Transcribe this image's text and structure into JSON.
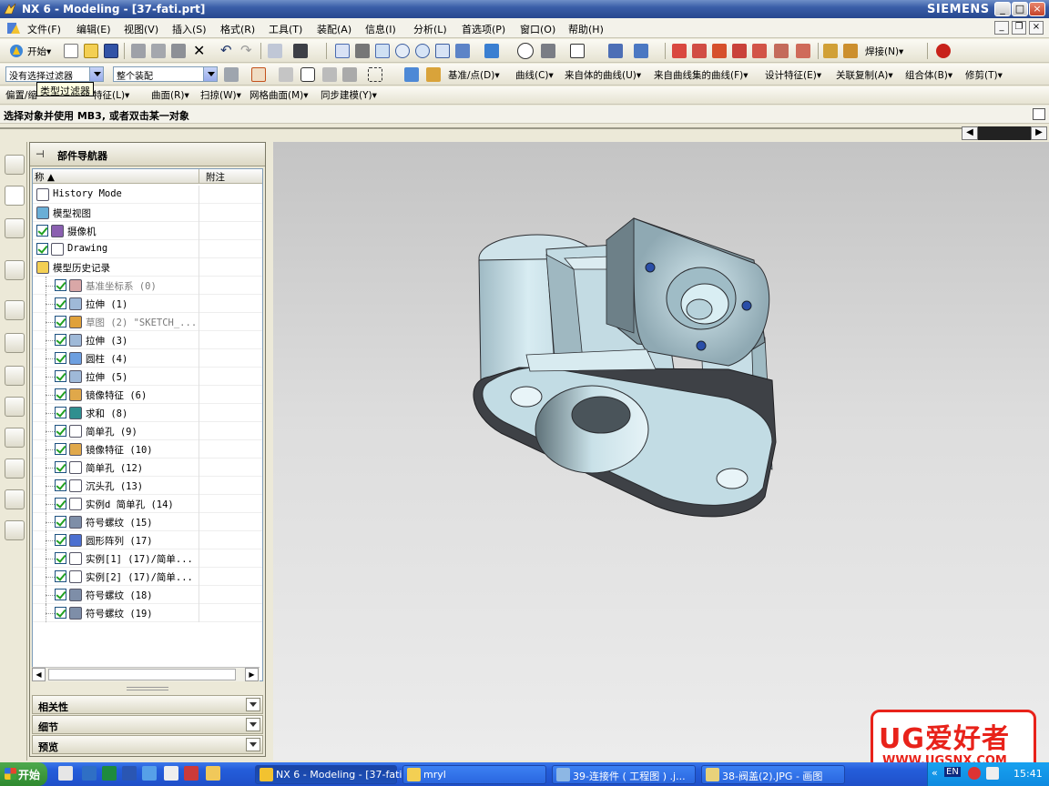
{
  "window": {
    "title": "NX 6 - Modeling - [37-fati.prt]",
    "brand": "SIEMENS",
    "min": "_",
    "max": "□",
    "close": "×"
  },
  "menu": [
    "文件(F)",
    "编辑(E)",
    "视图(V)",
    "插入(S)",
    "格式(R)",
    "工具(T)",
    "装配(A)",
    "信息(I)",
    "分析(L)",
    "首选项(P)",
    "窗口(O)",
    "帮助(H)"
  ],
  "toolbar1": {
    "start_label": "开始▾",
    "weld_label": "焊接(N)▾"
  },
  "toolbar2": {
    "filter_value": "没有选择过滤器",
    "scope_value": "整个装配",
    "items": [
      "基准/点(D)▾",
      "曲线(C)▾",
      "来自体的曲线(U)▾",
      "来自曲线集的曲线(F)▾",
      "设计特征(E)▾",
      "关联复制(A)▾",
      "组合体(B)▾",
      "修剪(T)▾"
    ]
  },
  "toolbar3": {
    "items": [
      "偏置/缩",
      "特征(L)▾",
      "曲面(R)▾",
      "扫掠(W)▾",
      "网格曲面(M)▾",
      "同步建模(Y)▾"
    ]
  },
  "tooltip": "类型过滤器",
  "status": "选择对象并使用 MB3, 或者双击某一对象",
  "navigator": {
    "title": "部件导航器",
    "col_name": "称",
    "col_note": "附注",
    "rows": [
      {
        "label": "History Mode",
        "check": false,
        "indent": 0,
        "icon": "clock-icon",
        "dim": false
      },
      {
        "label": "模型视图",
        "check": false,
        "indent": 0,
        "icon": "model-views-icon",
        "dim": false
      },
      {
        "label": "摄像机",
        "check": true,
        "indent": 0,
        "icon": "camera-icon",
        "dim": false
      },
      {
        "label": "Drawing",
        "check": true,
        "indent": 0,
        "icon": "drawing-icon",
        "dim": false
      },
      {
        "label": "模型历史记录",
        "check": false,
        "indent": 0,
        "icon": "folder-icon",
        "dim": false
      },
      {
        "label": "基准坐标系 (0)",
        "check": true,
        "indent": 1,
        "icon": "datum-csys-icon",
        "dim": true
      },
      {
        "label": "拉伸 (1)",
        "check": true,
        "indent": 1,
        "icon": "extrude-icon",
        "dim": false
      },
      {
        "label": "草图 (2) \"SKETCH_...",
        "check": true,
        "indent": 1,
        "icon": "sketch-icon",
        "dim": true
      },
      {
        "label": "拉伸 (3)",
        "check": true,
        "indent": 1,
        "icon": "extrude-icon",
        "dim": false
      },
      {
        "label": "圆柱 (4)",
        "check": true,
        "indent": 1,
        "icon": "cylinder-icon",
        "dim": false
      },
      {
        "label": "拉伸 (5)",
        "check": true,
        "indent": 1,
        "icon": "extrude-icon",
        "dim": false
      },
      {
        "label": "镜像特征 (6)",
        "check": true,
        "indent": 1,
        "icon": "mirror-feature-icon",
        "dim": false
      },
      {
        "label": "求和 (8)",
        "check": true,
        "indent": 1,
        "icon": "unite-icon",
        "dim": false
      },
      {
        "label": "简单孔 (9)",
        "check": true,
        "indent": 1,
        "icon": "hole-icon",
        "dim": false
      },
      {
        "label": "镜像特征 (10)",
        "check": true,
        "indent": 1,
        "icon": "mirror-feature-icon",
        "dim": false
      },
      {
        "label": "简单孔 (12)",
        "check": true,
        "indent": 1,
        "icon": "hole-icon",
        "dim": false
      },
      {
        "label": "沉头孔 (13)",
        "check": true,
        "indent": 1,
        "icon": "counterbore-hole-icon",
        "dim": false
      },
      {
        "label": "实例d 简单孔 (14)",
        "check": true,
        "indent": 1,
        "icon": "hole-icon",
        "dim": false
      },
      {
        "label": "符号螺纹 (15)",
        "check": true,
        "indent": 1,
        "icon": "thread-icon",
        "dim": false
      },
      {
        "label": "圆形阵列 (17)",
        "check": true,
        "indent": 1,
        "icon": "circular-array-icon",
        "dim": false
      },
      {
        "label": "实例[1] (17)/简单...",
        "check": true,
        "indent": 1,
        "icon": "hole-icon",
        "dim": false
      },
      {
        "label": "实例[2] (17)/简单...",
        "check": true,
        "indent": 1,
        "icon": "hole-icon",
        "dim": false
      },
      {
        "label": "符号螺纹 (18)",
        "check": true,
        "indent": 1,
        "icon": "thread-icon",
        "dim": false
      },
      {
        "label": "符号螺纹 (19)",
        "check": true,
        "indent": 1,
        "icon": "thread-icon",
        "dim": false
      }
    ],
    "panels": [
      "相关性",
      "细节",
      "预览"
    ]
  },
  "watermark": {
    "title": "UG爱好者",
    "url": "WWW.UGSNX.COM"
  },
  "taskbar": {
    "start": "开始",
    "tasks": [
      "NX 6 - Modeling - [37-fati...",
      "mryl",
      "39-连接件 ( 工程图 ) .j...",
      "38-阀盖(2).JPG - 画图"
    ],
    "lang": "EN",
    "clock": "15:41"
  },
  "colors": {
    "part_fill": "#b9d3dd",
    "part_dark": "#3c3f44",
    "viewport_top": "#c4c4c4",
    "viewport_bottom": "#ececec",
    "titlebar": "#3a5ea8"
  }
}
